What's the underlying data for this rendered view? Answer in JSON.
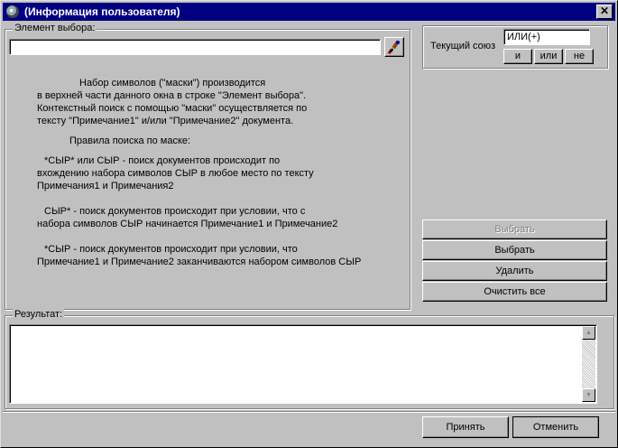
{
  "window": {
    "title": "(Информация пользователя)"
  },
  "element_group": {
    "legend": "Элемент выбора:",
    "input_value": "",
    "help_lines": [
      "Набор символов (\"маски\") производится",
      "в верхней части данного окна в строке \"Элемент выбора\".",
      "Контекстный поиск с помощью \"маски\" осуществляется по",
      "тексту \"Примечание1\" и/или \"Примечание2\" документа.",
      "Правила поиска по маске:",
      "*СЫР* или СЫР - поиск документов происходит по",
      "вхождению набора символов СЫР в любое место по тексту",
      "Примечания1 и Примечания2",
      "СЫР* - поиск документов происходит при условии, что с",
      "набора символов СЫР начинается Примечание1 и Примечание2",
      "*СЫР - поиск документов происходит при условии, что",
      "Примечание1 и Примечание2 заканчиваются набором символов СЫР"
    ]
  },
  "union": {
    "label": "Текущий союз",
    "value": "ИЛИ(+)",
    "and_label": "и",
    "or_label": "или",
    "not_label": "не"
  },
  "actions": {
    "select_disabled": "Выбрать",
    "select": "Выбрать",
    "delete": "Удалить",
    "clear_all": "Очистить все"
  },
  "result": {
    "legend": "Результат:"
  },
  "footer": {
    "accept": "Принять",
    "cancel": "Отменить"
  }
}
